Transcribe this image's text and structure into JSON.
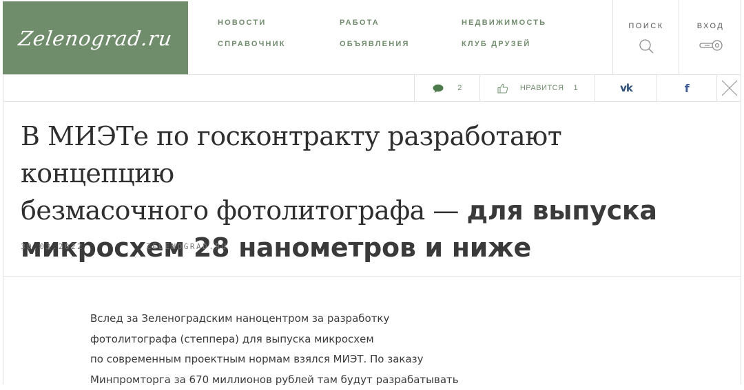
{
  "site": {
    "logo_text": "Zelenograd.ru"
  },
  "nav": {
    "items": [
      {
        "label": "НОВОСТИ"
      },
      {
        "label": "РАБОТА"
      },
      {
        "label": "НЕДВИЖИМОСТЬ"
      },
      {
        "label": "СПРАВОЧНИК"
      },
      {
        "label": "ОБЪЯВЛЕНИЯ"
      },
      {
        "label": "КЛУБ ДРУЗЕЙ"
      }
    ]
  },
  "tools": {
    "search_label": "ПОИСК",
    "search_icon": "search-icon",
    "login_label": "ВХОД",
    "login_icon": "key-icon"
  },
  "share": {
    "comments_count": "2",
    "like_label": "НРАВИТСЯ",
    "like_count": "1",
    "vk_label": "vk",
    "fb_label": "f"
  },
  "article": {
    "headline_serif_1": "В МИЭТе по госконтракту разработают концепцию",
    "headline_serif_2": "безмасочного фотолитографа — ",
    "headline_sans_2": "для выпуска",
    "headline_sans_3": "микросхем 28 нанометров и ниже",
    "date": "30.03.2022",
    "source": "ZELENOGRAD.RU",
    "body_lines": [
      "Вслед за Зеленоградским наноцентром за разработку",
      "фотолитографа (степпера) для выпуска микросхем",
      "по современным проектным нормам взялся МИЭТ. По заказу",
      "Минпромторга за 670 миллионов рублей там будут разрабатывать"
    ]
  },
  "colors": {
    "brand": "#6f8c6b",
    "border": "#e1e1e1",
    "text": "#2f2f2f"
  }
}
